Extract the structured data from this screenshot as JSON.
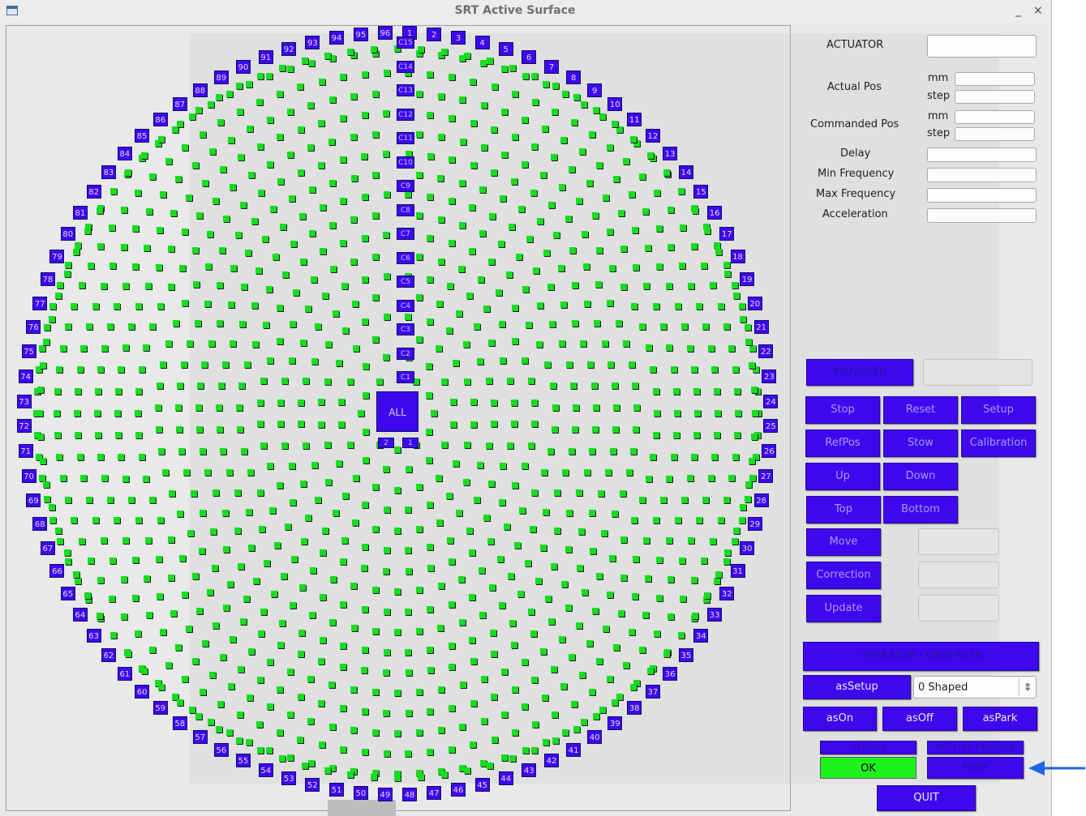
{
  "window": {
    "title": "SRT Active Surface",
    "minimize": "_",
    "close": "×"
  },
  "dish": {
    "ring_labels": [
      "1",
      "2",
      "3",
      "4",
      "5",
      "6",
      "7",
      "8",
      "9",
      "10",
      "11",
      "12",
      "13",
      "14",
      "15",
      "16",
      "17",
      "18",
      "19",
      "20",
      "21",
      "22",
      "23",
      "24",
      "25",
      "26",
      "27",
      "28",
      "29",
      "30",
      "31",
      "32",
      "33",
      "34",
      "35",
      "36",
      "37",
      "38",
      "39",
      "40",
      "41",
      "42",
      "43",
      "44",
      "45",
      "46",
      "47",
      "48",
      "49",
      "50",
      "51",
      "52",
      "53",
      "54",
      "55",
      "56",
      "57",
      "58",
      "59",
      "60",
      "61",
      "62",
      "63",
      "64",
      "65",
      "66",
      "67",
      "68",
      "69",
      "70",
      "71",
      "72",
      "73",
      "74",
      "75",
      "76",
      "77",
      "78",
      "79",
      "80",
      "81",
      "82",
      "83",
      "84",
      "85",
      "86",
      "87",
      "88",
      "89",
      "90",
      "91",
      "92",
      "93",
      "94",
      "95",
      "96"
    ],
    "circle_labels": [
      "C1",
      "C2",
      "C3",
      "C4",
      "C5",
      "C6",
      "C7",
      "C8",
      "C9",
      "C10",
      "C11",
      "C12",
      "C13",
      "C14",
      "C15"
    ],
    "small_labels": [
      "2",
      "1"
    ],
    "all_label": "ALL"
  },
  "actuator": {
    "title": "ACTUATOR",
    "actual_pos": "Actual Pos",
    "commanded_pos": "Commanded Pos",
    "unit_mm": "mm",
    "unit_step": "step",
    "delay": "Delay",
    "min_frequency": "Min Frequency",
    "max_frequency": "Max Frequency",
    "acceleration": "Acceleration"
  },
  "manager": {
    "label": "MANAGER",
    "stop": "Stop",
    "reset": "Reset",
    "setup": "Setup",
    "refpos": "RefPos",
    "stow": "Stow",
    "calibration": "Calibration",
    "up": "Up",
    "down": "Down",
    "top": "Top",
    "bottom": "Bottom",
    "move": "Move",
    "correction": "Correction",
    "update": "Update"
  },
  "operator": {
    "label": "OPERATOR / OBSERVER",
    "assetup": "asSetup",
    "profile_selected": "0 Shaped",
    "ason": "asOn",
    "asoff": "asOff",
    "aspark": "asPark",
    "status_label": "STATUS",
    "status_value": "OK",
    "profile_label": "ACTUAL PROFILE",
    "profile_value": "PARK",
    "quit": "QUIT"
  },
  "colors": {
    "button_blue": "#3e08ef",
    "actuator_green": "#18dc22",
    "status_ok": "#1ef21c",
    "arrow": "#1e64e6"
  },
  "icons": {
    "window_icon": "window-icon",
    "annotation": "arrow-left-icon"
  }
}
